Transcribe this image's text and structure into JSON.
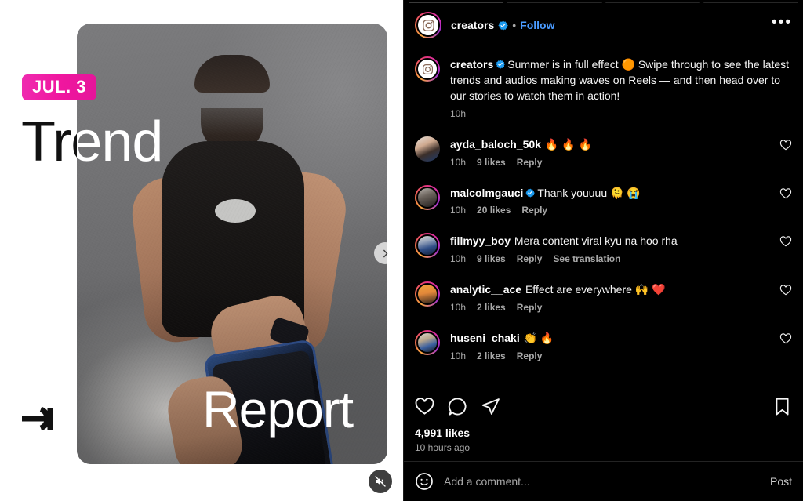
{
  "media": {
    "date_badge": "JUL. 3",
    "headline_top": "Trend",
    "headline_bottom": "Report",
    "arrow_icon": "arrow-right-to-bar-icon",
    "next_icon": "chevron-right-icon",
    "mute_icon": "speaker-muted-icon",
    "badge_color": "#ef2bb0"
  },
  "carousel": {
    "total": 4,
    "active_index": 0
  },
  "header": {
    "username": "creators",
    "verified": true,
    "separator": "•",
    "follow_label": "Follow",
    "more_icon": "more-options-icon",
    "avatar_icon": "instagram-camera-icon",
    "accent_color": "#4a9bff"
  },
  "caption": {
    "username": "creators",
    "verified": true,
    "text": "Summer is in full effect 🟠 Swipe through to see the latest trends and audios making waves on Reels — and then head over to our stories to watch them in action!",
    "time": "10h"
  },
  "comments": [
    {
      "username": "ayda_baloch_50k",
      "verified": false,
      "text": "🔥 🔥 🔥",
      "time": "10h",
      "likes": "9 likes",
      "reply": "Reply",
      "translate": "",
      "avatar_style": "plain"
    },
    {
      "username": "malcolmgauci",
      "verified": true,
      "text": "Thank youuuu 🫠 😭",
      "time": "10h",
      "likes": "20 likes",
      "reply": "Reply",
      "translate": "",
      "avatar_style": "ring"
    },
    {
      "username": "fillmyy_boy",
      "verified": false,
      "text": "Mera content viral kyu na hoo rha",
      "time": "10h",
      "likes": "9 likes",
      "reply": "Reply",
      "translate": "See translation",
      "avatar_style": "ring"
    },
    {
      "username": "analytic__ace",
      "verified": false,
      "text": "Effect are everywhere 🙌 ❤️",
      "time": "10h",
      "likes": "2 likes",
      "reply": "Reply",
      "translate": "",
      "avatar_style": "ring"
    },
    {
      "username": "huseni_chaki",
      "verified": false,
      "text": "👏 🔥",
      "time": "10h",
      "likes": "2 likes",
      "reply": "Reply",
      "translate": "",
      "avatar_style": "ring"
    }
  ],
  "actions": {
    "like_icon": "heart-icon",
    "comment_icon": "comment-bubble-icon",
    "share_icon": "share-paper-plane-icon",
    "save_icon": "bookmark-icon",
    "likes_count": "4,991 likes",
    "timestamp": "10 hours ago"
  },
  "compose": {
    "emoji_icon": "emoji-smiley-icon",
    "placeholder": "Add a comment...",
    "value": "",
    "post_label": "Post"
  }
}
